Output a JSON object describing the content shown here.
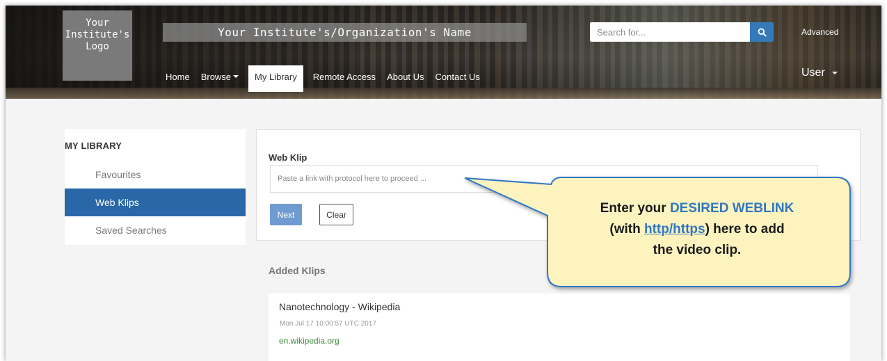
{
  "header": {
    "logo_lines": [
      "Your",
      "Institute's",
      "Logo"
    ],
    "org_name": "Your Institute's/Organization's Name",
    "search_placeholder": "Search for...",
    "advanced_label": "Advanced",
    "nav": [
      {
        "label": "Home"
      },
      {
        "label": "Browse"
      },
      {
        "label": "My Library"
      },
      {
        "label": "Remote Access"
      },
      {
        "label": "About Us"
      },
      {
        "label": "Contact Us"
      }
    ],
    "active_nav": "My Library",
    "user_label": "User"
  },
  "sidebar": {
    "heading": "MY LIBRARY",
    "items": [
      {
        "label": "Favourites"
      },
      {
        "label": "Web Klips"
      },
      {
        "label": "Saved Searches"
      }
    ],
    "active_item": "Web Klips"
  },
  "web_klip": {
    "title": "Web Klip",
    "input_placeholder": "Paste a link with protocol here to proceed ...",
    "next_label": "Next",
    "clear_label": "Clear"
  },
  "added_klips": {
    "title": "Added Klips",
    "items": [
      {
        "title": "Nanotechnology - Wikipedia",
        "date": "Mon Jul 17 10:00:57 UTC 2017",
        "domain": "en.wikipedia.org"
      }
    ]
  },
  "callout": {
    "part1": "Enter your ",
    "highlight1": "DESIRED WEBLINK",
    "part2": "(with ",
    "link": "http/https",
    "part3": ") here to add",
    "part4": "the video clip."
  },
  "colors": {
    "primary": "#2a67a8",
    "search_button": "#357ab8",
    "next_button": "#6f9bd0",
    "link_green": "#3c8a3c",
    "callout_fill": "#fdf3bf",
    "callout_border": "#2f77c2"
  }
}
